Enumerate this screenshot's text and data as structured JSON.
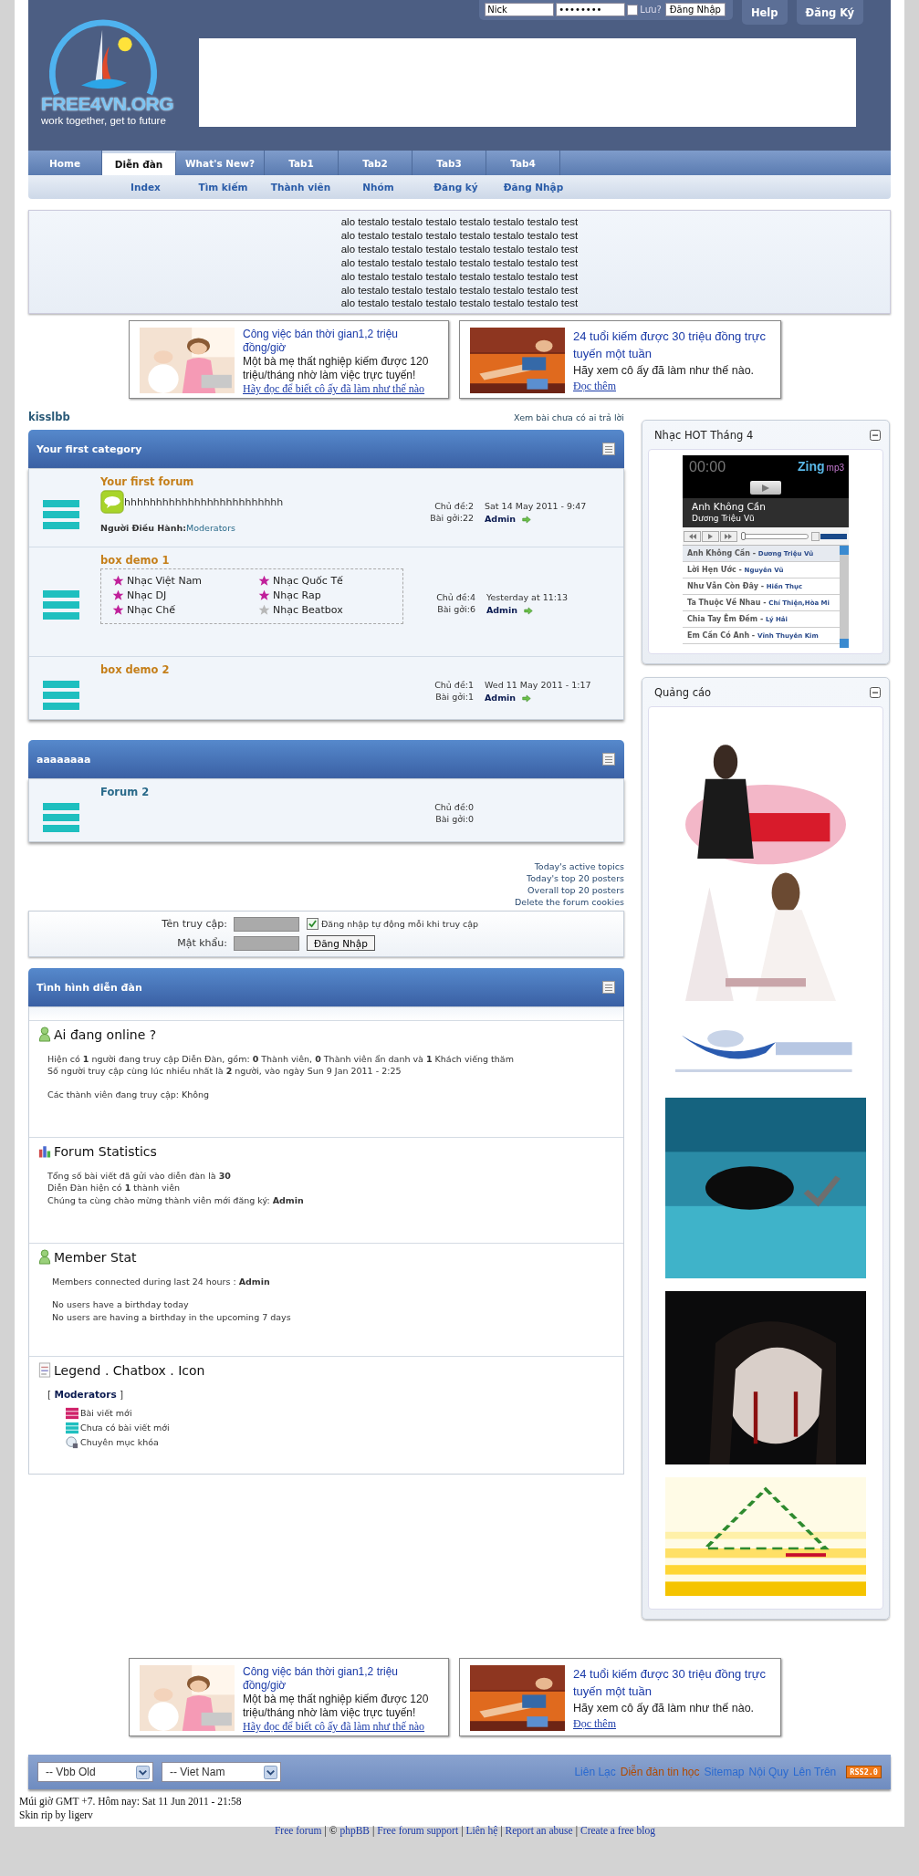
{
  "header": {
    "logo": {
      "name": "FREE4VN.ORG",
      "slogan": "work together, get to future"
    },
    "login": {
      "username": "Nick",
      "password": "••••••••",
      "remember_label": "Lưu?",
      "remember_checked": false,
      "button": "Đăng Nhập"
    },
    "buttons": [
      "Help",
      "Đăng Ký"
    ]
  },
  "tabs": [
    {
      "label": "Home",
      "selected": false
    },
    {
      "label": "Diễn đàn",
      "selected": true
    },
    {
      "label": "What's New?",
      "selected": false
    },
    {
      "label": "Tab1",
      "selected": false
    },
    {
      "label": "Tab2",
      "selected": false
    },
    {
      "label": "Tab3",
      "selected": false
    },
    {
      "label": "Tab4",
      "selected": false
    }
  ],
  "subnav": [
    "Index",
    "Tìm kiếm",
    "Thành viên",
    "Nhóm",
    "Đăng ký",
    "Đăng Nhập"
  ],
  "notice_lines": [
    "alo testalo testalo testalo testalo testalo testalo test",
    "alo testalo testalo testalo testalo testalo testalo test",
    "alo testalo testalo testalo testalo testalo testalo test",
    "alo testalo testalo testalo testalo testalo testalo test",
    "alo testalo testalo testalo testalo testalo testalo test",
    "alo testalo testalo testalo testalo testalo testalo test",
    "alo testalo testalo testalo testalo testalo testalo test"
  ],
  "ads_top": [
    {
      "kind": "picture",
      "title": "Công việc bán thời gian1,2 triệu đồng/giờ",
      "body": "Một bà mẹ thất nghiệp kiếm được 120 triệu/tháng nhờ làm việc trực tuyến!",
      "link": "Hãy đọc để biết cô ấy đã làm như thế nào"
    },
    {
      "kind": "picture",
      "title": "24 tuổi kiếm được 30 triệu đồng trực tuyến một tuần",
      "body": "Hãy xem cô ấy đã làm như thế nào.",
      "link": "Đọc thêm"
    }
  ],
  "user": "kisslbb",
  "unanswered_link": "Xem bài chưa có ai trả lời",
  "categories": [
    {
      "title": "Your first category",
      "forums": [
        {
          "name": "Your first forum",
          "description": "hhhhhhhhhhhhhhhhhhhhhhhhh",
          "moderators_label": "Người Điều Hành:",
          "moderators": "Moderators",
          "topics": "Chủ đề:2",
          "posts": "Bài gởi:22",
          "last_date": "Sat 14 May 2011 - 9:47",
          "last_user": "Admin"
        },
        {
          "name": "box demo 1",
          "subforums": [
            {
              "name": "Nhạc Việt Nam",
              "has_new": true
            },
            {
              "name": "Nhạc Quốc Tế",
              "has_new": true
            },
            {
              "name": "Nhạc DJ",
              "has_new": true
            },
            {
              "name": "Nhạc Rap",
              "has_new": true
            },
            {
              "name": "Nhạc Chế",
              "has_new": true
            },
            {
              "name": "Nhạc Beatbox",
              "has_new": false
            }
          ],
          "topics": "Chủ đề:4",
          "posts": "Bài gởi:6",
          "last_date": "Yesterday at 11:13",
          "last_user": "Admin"
        },
        {
          "name": "box demo 2",
          "topics": "Chủ đề:1",
          "posts": "Bài gởi:1",
          "last_date": "Wed 11 May 2011 - 1:17",
          "last_user": "Admin"
        }
      ]
    },
    {
      "title": "aaaaaaaa",
      "forums": [
        {
          "name": "Forum 2",
          "topics": "Chủ đề:0",
          "posts": "Bài gởi:0"
        }
      ]
    }
  ],
  "links": [
    "Today's active topics",
    "Today's top 20 posters",
    "Overall top 20 posters",
    "Delete the forum cookies"
  ],
  "login_form": {
    "username_label": "Tên truy cập:",
    "password_label": "Mật khẩu:",
    "auto_label": "Đăng nhập tự động mỗi khi truy cập",
    "auto_checked": true,
    "button": "Đăng Nhập"
  },
  "stats": {
    "title": "Tình hình diễn đàn",
    "sections": [
      {
        "kind": "person",
        "title": "Ai đang online ?",
        "paragraphs": [
          [
            "Hiện có **1** người đang truy cập Diễn Đàn, gồm: **0** Thành viên, **0** Thành viên ẩn danh và **1** Khách viếng thăm",
            "Số người truy cập cùng lúc nhiều nhất là **2** người, vào ngày Sun 9 Jan 2011 - 2:25"
          ],
          [
            "Các thành viên đang truy cập: Không"
          ]
        ]
      },
      {
        "kind": "chart",
        "title": "Forum Statistics",
        "paragraphs": [
          [
            "Tổng số bài viết đã gửi vào diễn đàn là **30**",
            "Diễn Đàn hiện có **1** thành viên",
            "Chúng ta cùng chào mừng thành viên mới đăng ký: **Admin**"
          ]
        ]
      },
      {
        "kind": "person",
        "title": "Member Stat",
        "paragraphs": [
          [
            "Members connected during last 24 hours : **Admin**"
          ],
          [
            "No users have a birthday today",
            "No users are having a birthday in the upcoming 7 days"
          ]
        ]
      },
      {
        "kind": "document",
        "title": "Legend . Chatbox . Icon",
        "group": "Moderators",
        "group_open": "[",
        "group_close": "]",
        "legend": [
          {
            "kind": "new",
            "label": "Bài viết mới"
          },
          {
            "kind": "old",
            "label": "Chưa có bài viết mới"
          },
          {
            "kind": "locked",
            "label": "Chuyên mục khóa"
          }
        ]
      }
    ]
  },
  "sidebar": [
    {
      "kind": "player",
      "title": "Nhạc HOT Tháng 4",
      "player": {
        "time": "00:00",
        "logo": "Zing",
        "logo_suffix": "mp3",
        "song": "Anh Không Cần",
        "artist": "Dương Triệu Vũ",
        "seek": {
          "level": 0
        },
        "separator": "-",
        "playlist": [
          {
            "song": "Anh Không Cần",
            "artist": "Dương Triệu Vũ",
            "selected": true
          },
          {
            "song": "Lời Hẹn Ước",
            "artist": "Nguyên Vũ",
            "selected": false
          },
          {
            "song": "Như Vẫn Còn Đây",
            "artist": "Hiền Thục",
            "selected": false
          },
          {
            "song": "Ta Thuộc Về Nhau",
            "artist": "Chí Thiện,Hòa Mi",
            "selected": false
          },
          {
            "song": "Chia Tay Êm Đềm",
            "artist": "Lý Hải",
            "selected": false
          },
          {
            "song": "Em Cần Có Anh",
            "artist": "Vĩnh Thuyên Kim",
            "selected": false
          }
        ]
      }
    },
    {
      "kind": "ads",
      "title": "Quảng cáo"
    }
  ],
  "ads_bottom": [
    {
      "kind": "picture",
      "title": "Công việc bán thời gian1,2 triệu đồng/giờ",
      "body": "Một bà mẹ thất nghiệp kiếm được 120 triệu/tháng nhờ làm việc trực tuyến!",
      "link": "Hãy đọc để biết cô ấy đã làm như thế nào"
    },
    {
      "kind": "picture",
      "title": "24 tuổi kiếm được 30 triệu đồng trực tuyến một tuần",
      "body": "Hãy xem cô ấy đã làm như thế nào.",
      "link": "Đọc thêm"
    }
  ],
  "footer": {
    "selects": [
      "-- Vbb Old",
      "-- Viet Nam"
    ],
    "links": [
      {
        "label": "Liên Lạc",
        "highlighted": false
      },
      {
        "label": "Diễn đàn tin học",
        "highlighted": true
      },
      {
        "label": "Sitemap",
        "highlighted": false
      },
      {
        "label": "Nội Quy",
        "highlighted": false
      },
      {
        "label": "Lên Trên",
        "highlighted": false
      }
    ],
    "rss": "RSS2.0",
    "timezone": "Múi giờ GMT +7. Hôm nay: Sat 11 Jun 2011 - 21:58",
    "credit": "Skin rip by ligerv",
    "separator": "|",
    "bottom_links": [
      {
        "label": "Free forum"
      },
      {
        "prefix": "©",
        "label": "phpBB"
      },
      {
        "label": "Free forum support"
      },
      {
        "label": "Liên hệ"
      },
      {
        "label": "Report an abuse"
      },
      {
        "label": "Create a free blog"
      }
    ]
  }
}
